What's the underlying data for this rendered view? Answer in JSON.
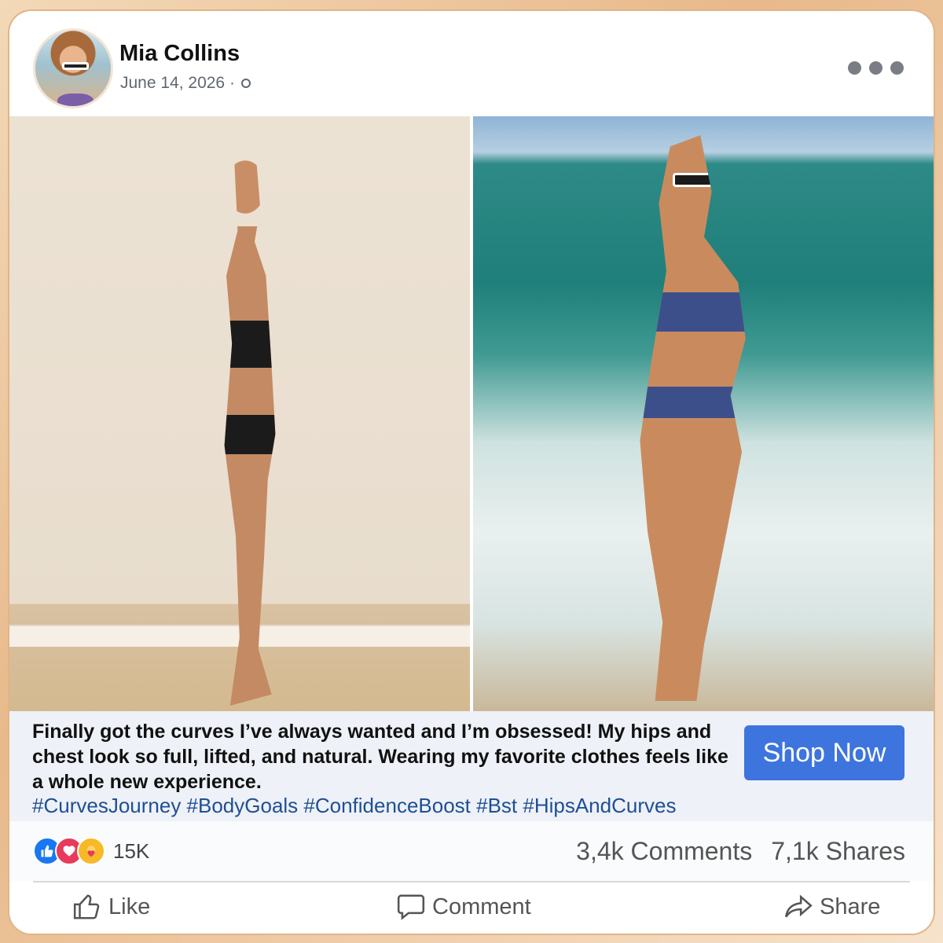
{
  "post": {
    "author": "Mia Collins",
    "date": "June 14, 2026 ·",
    "caption": "Finally got the curves I’ve always wanted and I’m obsessed! My hips and chest look so full, lifted, and natural. Wearing my favorite clothes feels like a whole new experience.",
    "hashtags": "#CurvesJourney #BodyGoals #ConfidenceBoost #Bst #HipsAndCurves",
    "cta_label": "Shop Now"
  },
  "stats": {
    "reaction_count": "15K",
    "comments": "3,4k Comments",
    "shares": "7,1k Shares",
    "reaction_icons": [
      "like-icon",
      "love-icon",
      "care-icon"
    ]
  },
  "actions": {
    "like_label": "Like",
    "comment_label": "Comment",
    "share_label": "Share"
  },
  "colors": {
    "cta": "#3d74de",
    "hashtag": "#1e4f94",
    "like": "#1877f2",
    "love": "#e83a5a",
    "care": "#f7b928"
  }
}
